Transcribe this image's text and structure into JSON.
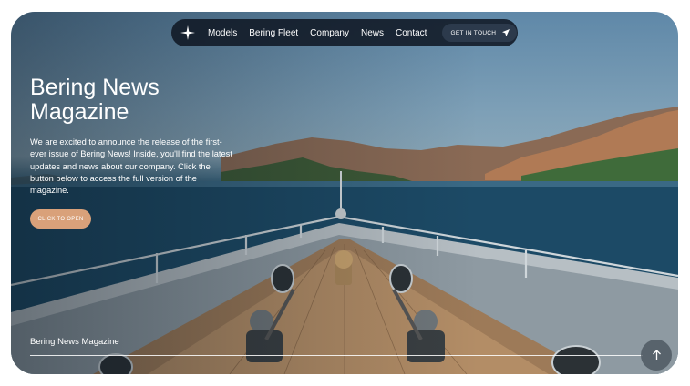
{
  "nav": {
    "logo_icon": "star-logo-icon",
    "links": [
      "Models",
      "Bering Fleet",
      "Company",
      "News",
      "Contact"
    ],
    "cta_label": "GET IN TOUCH",
    "cta_icon": "send-icon"
  },
  "hero": {
    "title": "Bering News Magazine",
    "description": "We are excited to announce the release of the first-ever issue of Bering News! Inside, you'll find the latest updates and news about our company. Click the button below to access the full version of the magazine.",
    "button_label": "CLICK TO OPEN",
    "button_color": "#d9a17a",
    "bottom_label": "Bering News Magazine",
    "scroll_icon": "arrow-up-icon"
  }
}
